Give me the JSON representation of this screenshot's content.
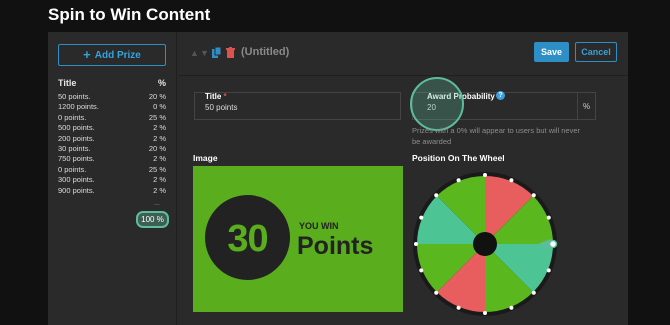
{
  "page": {
    "title": "Spin to Win Content"
  },
  "sidebar": {
    "add_label": "Add Prize",
    "header": {
      "title": "Title",
      "pct": "%"
    },
    "prizes": [
      {
        "title": "50 points.",
        "pct": "20 %"
      },
      {
        "title": "1200 points.",
        "pct": "0 %"
      },
      {
        "title": "0 points.",
        "pct": "25 %"
      },
      {
        "title": "500 points.",
        "pct": "2 %"
      },
      {
        "title": "200 points.",
        "pct": "2 %"
      },
      {
        "title": "30 points.",
        "pct": "20 %"
      },
      {
        "title": "750 points.",
        "pct": "2 %"
      },
      {
        "title": "0 points.",
        "pct": "25 %"
      },
      {
        "title": "300 points.",
        "pct": "2 %"
      },
      {
        "title": "900 points.",
        "pct": "2 %"
      }
    ],
    "ellipsis": "...",
    "total": "100 %"
  },
  "toolbar": {
    "title": "(Untitled)",
    "save_label": "Save",
    "cancel_label": "Cancel"
  },
  "form": {
    "title_label": "Title",
    "required_mark": "*",
    "title_value": "50 points",
    "prob_label": "Award Probability",
    "prob_value": "20",
    "prob_unit": "%",
    "hint": "Prizes with a 0% will appear to users but will never be awarded",
    "image_label": "Image",
    "position_label": "Position On The Wheel"
  },
  "prize_image": {
    "number": "30",
    "you_win": "YOU WIN",
    "points": "Points"
  },
  "wheel": {
    "segments": [
      "#e85d5d",
      "#5ab81e",
      "#4cc494",
      "#5ab81e",
      "#e85d5d",
      "#5ab81e",
      "#4cc494",
      "#5ab81e"
    ],
    "accent": "#5dbd9b"
  },
  "colors": {
    "accent": "#2d8fc5",
    "highlight": "#5dbd9b",
    "image_bg": "#5aad1c"
  }
}
